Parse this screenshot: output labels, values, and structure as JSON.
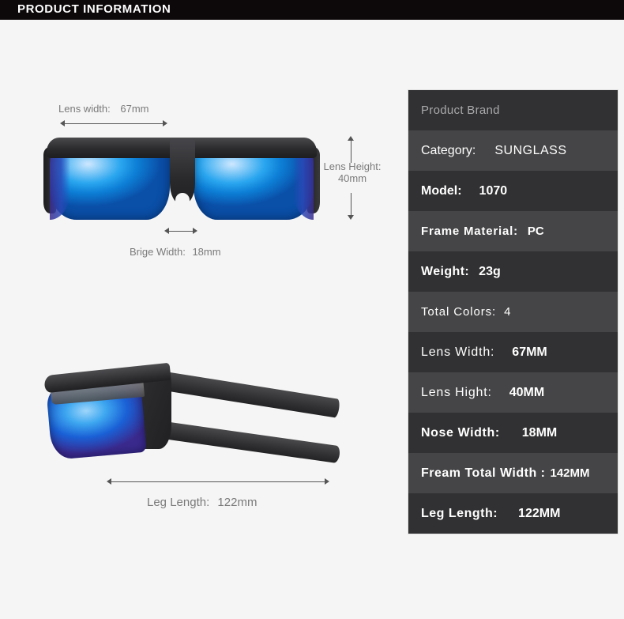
{
  "header": {
    "title": "PRODUCT INFORMATION",
    "background": "#0d0809",
    "text_color": "#ffffff"
  },
  "page": {
    "background": "#f5f5f5"
  },
  "product_images": {
    "front_view": {
      "name": "sunglasses-front-view",
      "description": "Wraparound sport sunglasses, front view, black frame with blue mirrored lenses",
      "frame_color": "#2b2b2d",
      "lens_color": "#2aa6ef"
    },
    "side_view": {
      "name": "sunglasses-side-view",
      "description": "Wraparound sport sunglasses, side/profile view showing temple arm",
      "frame_color": "#313133",
      "lens_color": "#1a60d6"
    }
  },
  "annotations": [
    {
      "id": "lens-width",
      "label": "Lens width:",
      "value": "67mm",
      "orientation": "horizontal"
    },
    {
      "id": "lens-height",
      "label": "Lens Height:",
      "value": "40mm",
      "orientation": "vertical"
    },
    {
      "id": "brige-width",
      "label": "Brige Width:",
      "value": "18mm",
      "orientation": "horizontal"
    },
    {
      "id": "leg-length",
      "label": "Leg Length:",
      "value": "122mm",
      "orientation": "horizontal"
    }
  ],
  "annotation_text_color": "#7a7a7a",
  "spec_table": {
    "row_color_dark": "#313133",
    "row_color_light": "#454547",
    "text_color": "#ffffff",
    "rows": [
      {
        "label": "Product Brand",
        "value": ""
      },
      {
        "label": "Category:",
        "value": "SUNGLASS"
      },
      {
        "label": "Model:",
        "value": "1070"
      },
      {
        "label": "Frame Material:",
        "value": "PC"
      },
      {
        "label": "Weight:",
        "value": "23g"
      },
      {
        "label": "Total Colors:",
        "value": "4"
      },
      {
        "label": "Lens Width:",
        "value": "67MM"
      },
      {
        "label": "Lens Hight:",
        "value": "40MM"
      },
      {
        "label": "Nose Width:",
        "value": "18MM"
      },
      {
        "label": "Fream Total Width :",
        "value": "142MM"
      },
      {
        "label": "Leg Length:",
        "value": "122MM"
      }
    ]
  }
}
